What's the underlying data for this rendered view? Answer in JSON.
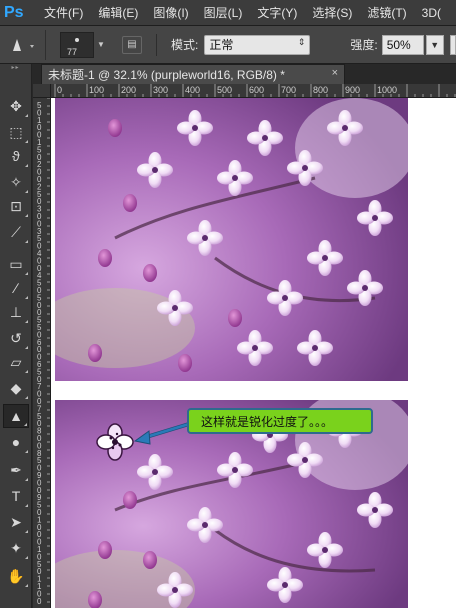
{
  "menu": {
    "logo": "Ps",
    "items": [
      "文件(F)",
      "编辑(E)",
      "图像(I)",
      "图层(L)",
      "文字(Y)",
      "选择(S)",
      "滤镜(T)",
      "3D("
    ]
  },
  "options_bar": {
    "brush_size": "77",
    "mode_label": "模式:",
    "mode_value": "正常",
    "strength_label": "强度:",
    "strength_value": "50%"
  },
  "document_tab": {
    "title": "未标题-1 @ 32.1% (purpleworld16, RGB/8) *",
    "close_glyph": "×"
  },
  "ruler": {
    "top_labels": [
      "0",
      "100",
      "200",
      "300",
      "400",
      "500",
      "600",
      "700",
      "800",
      "900",
      "1000"
    ],
    "left_labels": [
      "5",
      "0",
      "1",
      "0",
      "0",
      "1",
      "5",
      "0",
      "2",
      "0",
      "0",
      "2",
      "5",
      "0",
      "3",
      "0",
      "0",
      "3",
      "5",
      "0",
      "4",
      "0",
      "0",
      "4",
      "5",
      "0",
      "5",
      "0",
      "0",
      "5",
      "5",
      "0",
      "6",
      "0",
      "0",
      "6",
      "5",
      "0",
      "7",
      "0",
      "0",
      "7",
      "5",
      "0",
      "8",
      "0",
      "0",
      "8",
      "5",
      "0",
      "9",
      "0",
      "0",
      "9",
      "5",
      "0",
      "1",
      "0",
      "0",
      "0",
      "1",
      "0",
      "5",
      "0",
      "1",
      "1",
      "0",
      "0"
    ]
  },
  "annotation": {
    "text": "这样就是锐化过度了。。。"
  },
  "colors": {
    "app_bg": "#282828",
    "panel_bg": "#3b3b3b",
    "callout_fill": "#7ad21c",
    "callout_border": "#2e6a8e",
    "arrow": "#2a7ab8",
    "brand_blue": "#31a8ff"
  },
  "tools": [
    {
      "name": "move-tool",
      "icon": "move-icon"
    },
    {
      "name": "marquee-tool",
      "icon": "marquee-icon"
    },
    {
      "name": "lasso-tool",
      "icon": "lasso-icon"
    },
    {
      "name": "magic-wand-tool",
      "icon": "magic-wand-icon"
    },
    {
      "name": "crop-tool",
      "icon": "crop-icon"
    },
    {
      "name": "eyedropper-tool",
      "icon": "eyedropper-icon"
    },
    {
      "name": "healing-brush-tool",
      "icon": "bandage-icon"
    },
    {
      "name": "brush-tool",
      "icon": "brush-icon"
    },
    {
      "name": "clone-stamp-tool",
      "icon": "stamp-icon"
    },
    {
      "name": "history-brush-tool",
      "icon": "history-brush-icon"
    },
    {
      "name": "eraser-tool",
      "icon": "eraser-icon"
    },
    {
      "name": "paint-bucket-tool",
      "icon": "bucket-icon"
    },
    {
      "name": "sharpen-tool",
      "icon": "sharpen-icon"
    },
    {
      "name": "dodge-tool",
      "icon": "dodge-icon"
    },
    {
      "name": "pen-tool",
      "icon": "pen-icon"
    },
    {
      "name": "type-tool",
      "icon": "type-icon"
    },
    {
      "name": "path-selection-tool",
      "icon": "arrow-select-icon"
    },
    {
      "name": "custom-shape-tool",
      "icon": "shape-icon"
    },
    {
      "name": "hand-tool",
      "icon": "hand-icon"
    }
  ]
}
